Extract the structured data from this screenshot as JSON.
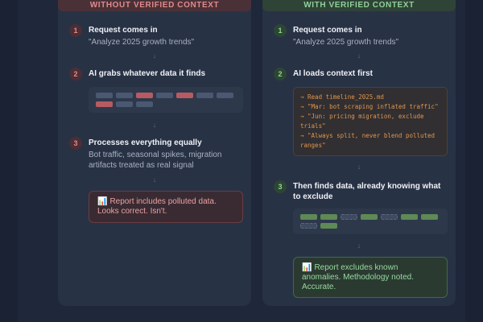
{
  "left": {
    "header": "WITHOUT VERIFIED CONTEXT",
    "steps": [
      {
        "num": "1",
        "title": "Request comes in",
        "sub": "\"Analyze 2025 growth trends\""
      },
      {
        "num": "2",
        "title": "AI grabs whatever data it finds",
        "sub": ""
      },
      {
        "num": "3",
        "title": "Processes everything equally",
        "sub": "Bot traffic, seasonal spikes, migration artifacts treated as real signal"
      }
    ],
    "result_icon": "chart-icon",
    "result": "Report includes polluted data. Looks correct. Isn't."
  },
  "right": {
    "header": "WITH VERIFIED CONTEXT",
    "steps": [
      {
        "num": "1",
        "title": "Request comes in",
        "sub": "\"Analyze 2025 growth trends\""
      },
      {
        "num": "2",
        "title": "AI loads context first",
        "sub": ""
      },
      {
        "num": "3",
        "title": "Then finds data, already knowing what to exclude",
        "sub": ""
      }
    ],
    "context_lines": [
      "→ Read timeline_2025.md",
      "→ \"Mar: bot scraping inflated traffic\"",
      "→ \"Jun: pricing migration, exclude trials\"",
      "→ \"Always split, never blend polluted ranges\""
    ],
    "result_icon": "chart-icon",
    "result": "Report excludes known anomalies. Methodology noted. Accurate."
  },
  "arrow": "↓",
  "colors": {
    "bad_pill": "#b85a62",
    "neutral_pill": "#4a5872",
    "good_pill": "#5e8a55",
    "excluded_pill": "#3e4a60"
  }
}
